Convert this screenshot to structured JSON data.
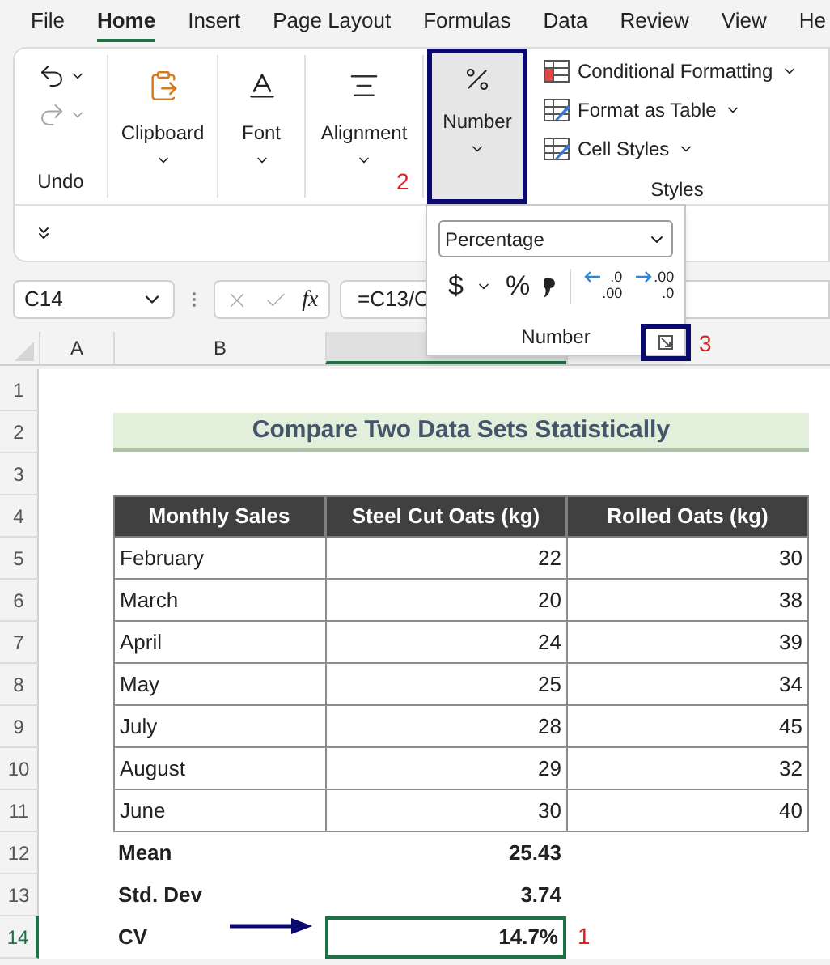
{
  "menu_tabs": [
    {
      "label": "File",
      "selected": false
    },
    {
      "label": "Home",
      "selected": true
    },
    {
      "label": "Insert",
      "selected": false
    },
    {
      "label": "Page Layout",
      "selected": false
    },
    {
      "label": "Formulas",
      "selected": false
    },
    {
      "label": "Data",
      "selected": false
    },
    {
      "label": "Review",
      "selected": false
    },
    {
      "label": "View",
      "selected": false
    },
    {
      "label": "He",
      "selected": false
    }
  ],
  "ribbon": {
    "undo_group": {
      "label": "Undo",
      "redo_disabled": true
    },
    "groups": [
      {
        "label": "Clipboard",
        "kind": "clipboard"
      },
      {
        "label": "Font",
        "kind": "font"
      },
      {
        "label": "Alignment",
        "kind": "alignment"
      }
    ],
    "number_button": {
      "label": "Number",
      "highlighted": true
    },
    "styles_group": {
      "label": "Styles",
      "items": [
        {
          "label": "Conditional Formatting",
          "kind": "conditional"
        },
        {
          "label": "Format as Table",
          "kind": "table"
        },
        {
          "label": "Cell Styles",
          "kind": "styles"
        }
      ]
    }
  },
  "number_popup": {
    "format": "Percentage",
    "currency": "$",
    "percent": "%",
    "decimal_buttons": [
      {
        "top": ".0",
        "bottom": ".00",
        "kind": "increase"
      },
      {
        "top": ".00",
        "bottom": ".0",
        "kind": "decrease"
      }
    ],
    "label": "Number",
    "launcher_highlighted": true
  },
  "step_labels": {
    "number_button": "2",
    "dialog_launcher": "3",
    "cell": "1"
  },
  "formula_bar": {
    "name_box": "C14",
    "formula": "=C13/C",
    "function_label": "fx"
  },
  "column_headers": [
    {
      "label": "A",
      "selected": false
    },
    {
      "label": "B",
      "selected": false
    },
    {
      "selected": true
    },
    {
      "selected": false
    }
  ],
  "sheet_rows": [
    {
      "number": "1",
      "kind": "blank",
      "selected": false
    },
    {
      "number": "2",
      "kind": "title",
      "text": "Compare Two Data Sets Statistically",
      "selected": false
    },
    {
      "number": "3",
      "kind": "blank",
      "selected": false
    },
    {
      "number": "4",
      "kind": "header",
      "cells": [
        "Monthly Sales",
        "Steel Cut Oats (kg)",
        "Rolled Oats (kg)"
      ],
      "selected": false
    },
    {
      "number": "5",
      "kind": "data",
      "cells": [
        "February",
        "22",
        "30"
      ],
      "selected": false
    },
    {
      "number": "6",
      "kind": "data",
      "cells": [
        "March",
        "20",
        "38"
      ],
      "selected": false
    },
    {
      "number": "7",
      "kind": "data",
      "cells": [
        "April",
        "24",
        "39"
      ],
      "selected": false
    },
    {
      "number": "8",
      "kind": "data",
      "cells": [
        "May",
        "25",
        "34"
      ],
      "selected": false
    },
    {
      "number": "9",
      "kind": "data",
      "cells": [
        "July",
        "28",
        "45"
      ],
      "selected": false
    },
    {
      "number": "10",
      "kind": "data",
      "cells": [
        "August",
        "29",
        "32"
      ],
      "selected": false
    },
    {
      "number": "11",
      "kind": "data",
      "cells": [
        "June",
        "30",
        "40"
      ],
      "selected": false
    },
    {
      "number": "12",
      "kind": "stat",
      "cells": [
        "Mean",
        "25.43"
      ],
      "selected": false
    },
    {
      "number": "13",
      "kind": "stat",
      "cells": [
        "Std. Dev",
        "3.74"
      ],
      "selected": false
    },
    {
      "number": "14",
      "kind": "stat",
      "cells": [
        "CV",
        "14.7%"
      ],
      "selected": true
    }
  ]
}
